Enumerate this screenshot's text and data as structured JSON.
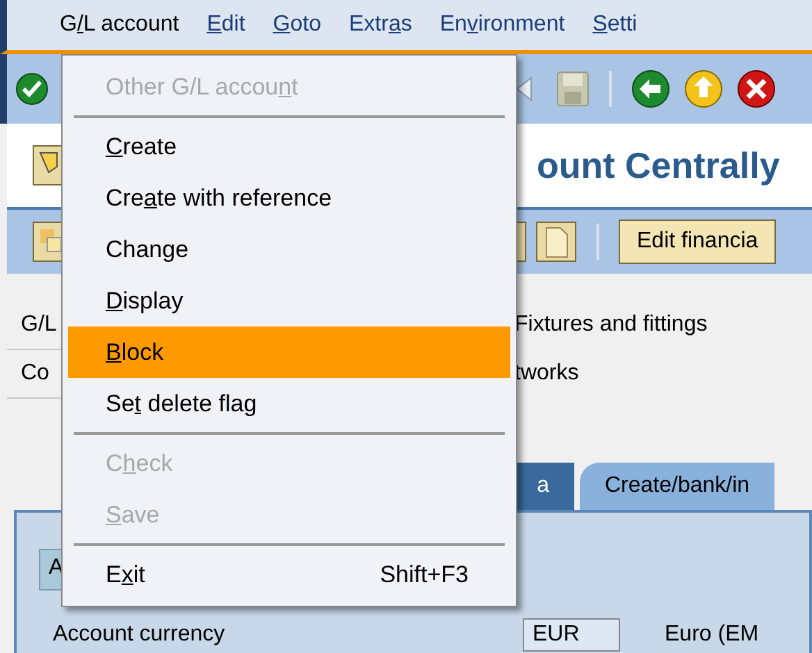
{
  "menu_bar": [
    {
      "before": "G",
      "key": "/",
      "after": "L account",
      "open": true
    },
    {
      "key": "E",
      "after": "dit",
      "open": false
    },
    {
      "key": "G",
      "after": "oto",
      "open": false
    },
    {
      "before": "Extr",
      "key": "a",
      "after": "s",
      "open": false
    },
    {
      "before": "En",
      "key": "v",
      "after": "ironment",
      "open": false
    },
    {
      "key": "S",
      "after": "etti",
      "open": false
    }
  ],
  "dropdown": [
    {
      "kind": "item",
      "before": "Other G/L accou",
      "key": "n",
      "after": "t",
      "disabled": true,
      "selected": false
    },
    {
      "kind": "separator"
    },
    {
      "kind": "item",
      "key": "C",
      "after": "reate",
      "disabled": false,
      "selected": false
    },
    {
      "kind": "item",
      "before": "Cre",
      "key": "a",
      "after": "te with reference",
      "disabled": false,
      "selected": false
    },
    {
      "kind": "item",
      "before": "Change",
      "disabled": false,
      "selected": false
    },
    {
      "kind": "item",
      "key": "D",
      "after": "isplay",
      "disabled": false,
      "selected": false
    },
    {
      "kind": "item",
      "key": "B",
      "after": "lock",
      "disabled": false,
      "selected": true
    },
    {
      "kind": "item",
      "before": "Se",
      "key": "t",
      "after": " delete flag",
      "disabled": false,
      "selected": false
    },
    {
      "kind": "separator"
    },
    {
      "kind": "item",
      "before": "C",
      "key": "h",
      "after": "eck",
      "disabled": true,
      "selected": false
    },
    {
      "kind": "item",
      "key": "S",
      "after": "ave",
      "disabled": true,
      "selected": false
    },
    {
      "kind": "separator"
    },
    {
      "kind": "item",
      "before": "E",
      "key": "x",
      "after": "it",
      "disabled": false,
      "selected": false,
      "shortcut": "Shift+F3"
    }
  ],
  "title": "ount Centrally",
  "app_toolbar": {
    "button": "Edit financia"
  },
  "fields": [
    {
      "label": "G/L",
      "value": "Fixtures and fittings"
    },
    {
      "label": "Co",
      "value": "tworks"
    }
  ],
  "tabs": [
    {
      "label": "a",
      "selected": true
    },
    {
      "label": "Create/bank/in",
      "selected": false
    }
  ],
  "subtab": "A",
  "currency": {
    "label": "Account currency",
    "value": "EUR",
    "description": "Euro (EM"
  }
}
